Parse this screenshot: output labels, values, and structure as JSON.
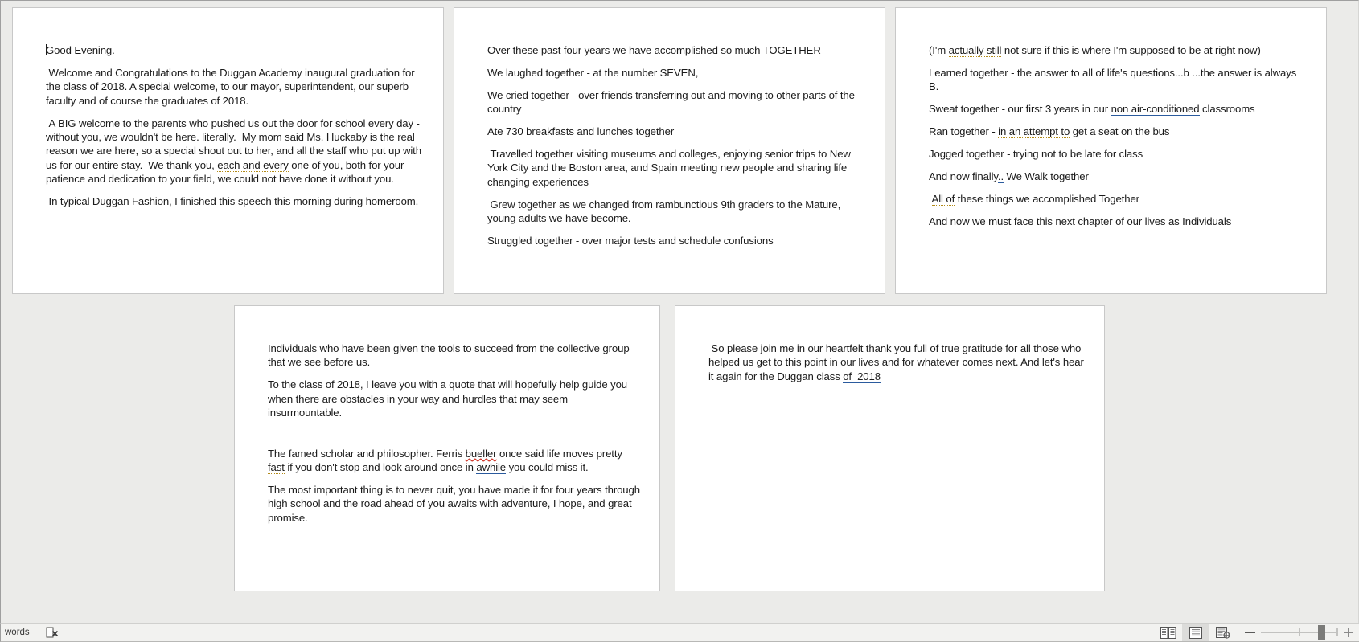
{
  "app": {
    "name": "word-processor",
    "view_mode": "Print Layout",
    "background_color": "#ebebe9",
    "page_color": "#ffffff"
  },
  "document": {
    "title": "Duggan Academy Graduation Speech",
    "pages": [
      {
        "page_number": 1,
        "paragraphs": [
          {
            "id": "p1-1",
            "text": "Good Evening.",
            "caret_at_start": true
          },
          {
            "id": "p1-2",
            "text": " Welcome and Congratulations to the Duggan Academy inaugural graduation for the class of 2018. A special welcome, to our mayor, superintendent, our superb faculty and of course the graduates of 2018."
          },
          {
            "id": "p1-3",
            "text": " A BIG welcome to the parents who pushed us out the door for school every day - without you, we wouldn't be here. literally.  My mom said Ms. Huckaby is the real reason we are here, so a special shout out to her, and all the staff who put up with us for our entire stay.  We thank you, each and every one of you, both for your patience and dedication to your field, we could not have done it without you.",
            "grammar_underline": "each and every"
          },
          {
            "id": "p1-4",
            "text": " In typical Duggan Fashion, I finished this speech this morning during homeroom."
          }
        ]
      },
      {
        "page_number": 2,
        "paragraphs": [
          {
            "id": "p2-1",
            "text": "Over these past four years we have accomplished so much TOGETHER"
          },
          {
            "id": "p2-2",
            "text": "We laughed together - at the number SEVEN,"
          },
          {
            "id": "p2-3",
            "text": "We cried together - over friends transferring out and moving to other parts of the country"
          },
          {
            "id": "p2-4",
            "text": "Ate 730 breakfasts and lunches together"
          },
          {
            "id": "p2-5",
            "text": " Travelled together visiting museums and colleges, enjoying senior trips to New York City and the Boston area, and Spain meeting new people and sharing life changing experiences"
          },
          {
            "id": "p2-6",
            "text": " Grew together as we changed from rambunctious 9th graders to the Mature, young adults we have become."
          },
          {
            "id": "p2-7",
            "text": "Struggled together - over major tests and schedule confusions"
          }
        ]
      },
      {
        "page_number": 3,
        "paragraphs": [
          {
            "id": "p3-1",
            "text": "(I'm actually still not sure if this is where I'm supposed to be at right now)",
            "grammar_underline": "actually still"
          },
          {
            "id": "p3-2",
            "text": "Learned together - the answer to all of life's questions...b ...the answer is always B."
          },
          {
            "id": "p3-3",
            "text": "Sweat together - our first 3 years in our non air-conditioned classrooms",
            "style_underline": "non air-conditioned"
          },
          {
            "id": "p3-4",
            "text": "Ran together - in an attempt to get a seat on the bus",
            "grammar_underline": "in an attempt to"
          },
          {
            "id": "p3-5",
            "text": "Jogged together - trying not to be late for class"
          },
          {
            "id": "p3-6",
            "text": "And now finally .. We Walk together",
            "style_underline": ".."
          },
          {
            "id": "p3-7",
            "text": " All of these things we accomplished Together",
            "grammar_underline": "All of"
          },
          {
            "id": "p3-8",
            "text": "And now we must face this next chapter of our lives as Individuals"
          }
        ]
      },
      {
        "page_number": 4,
        "paragraphs": [
          {
            "id": "p4-1",
            "text": "Individuals who have been given the tools to succeed from the collective group that we see before us."
          },
          {
            "id": "p4-2",
            "text": "To the class of 2018, I leave you with a quote that will hopefully help guide you when there are obstacles in your way and hurdles that may seem insurmountable."
          },
          {
            "id": "p4-3",
            "text": "The famed scholar and philosopher. Ferris bueller once said life moves pretty fast if you don't stop and look around once in awhile you could miss it.",
            "spell_underline": "bueller",
            "grammar_underline": "pretty fast",
            "style_underline": "awhile"
          },
          {
            "id": "p4-4",
            "text": "The most important thing is to never quit, you have made it for four years through high school and the road ahead of you awaits with adventure, I hope, and great promise."
          }
        ]
      },
      {
        "page_number": 5,
        "paragraphs": [
          {
            "id": "p5-1",
            "text": " So please join me in our heartfelt thank you full of true gratitude for all those who helped us get to this point in our lives and for whatever comes next. And let's hear it again for the Duggan class of  2018",
            "style_underline": "of  2018"
          }
        ]
      }
    ]
  },
  "status_bar": {
    "word_count_label": "words",
    "proofing_icon": "proofing-errors-icon",
    "view_buttons": [
      {
        "name": "read-mode",
        "label": "Read Mode",
        "icon": "book-icon",
        "active": false
      },
      {
        "name": "print-layout",
        "label": "Print Layout",
        "icon": "page-lines-icon",
        "active": true
      },
      {
        "name": "web-layout",
        "label": "Web Layout",
        "icon": "page-globe-icon",
        "active": false
      }
    ],
    "zoom": {
      "out_label": "−",
      "in_label": "+",
      "slider_position_percent": 78
    }
  }
}
